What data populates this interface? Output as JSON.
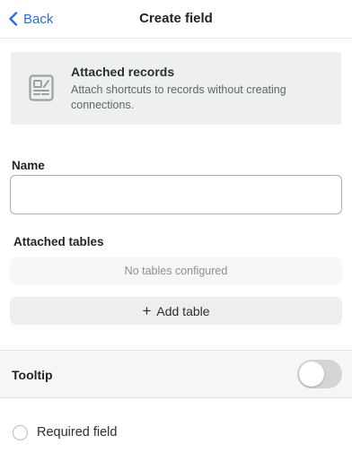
{
  "header": {
    "back_label": "Back",
    "title": "Create field"
  },
  "info_card": {
    "icon": "attached-records-icon",
    "title": "Attached records",
    "description": "Attach shortcuts to records without creating connections."
  },
  "name_field": {
    "label": "Name",
    "value": "",
    "placeholder": ""
  },
  "attached_tables": {
    "label": "Attached tables",
    "empty_text": "No tables configured",
    "add_label": "Add table"
  },
  "tooltip": {
    "label": "Tooltip",
    "enabled": false
  },
  "required": {
    "label": "Required field",
    "checked": false
  },
  "colors": {
    "accent": "#2d6cdf",
    "card_bg": "#eef0ed",
    "toggle_off": "#d2d4d6"
  }
}
